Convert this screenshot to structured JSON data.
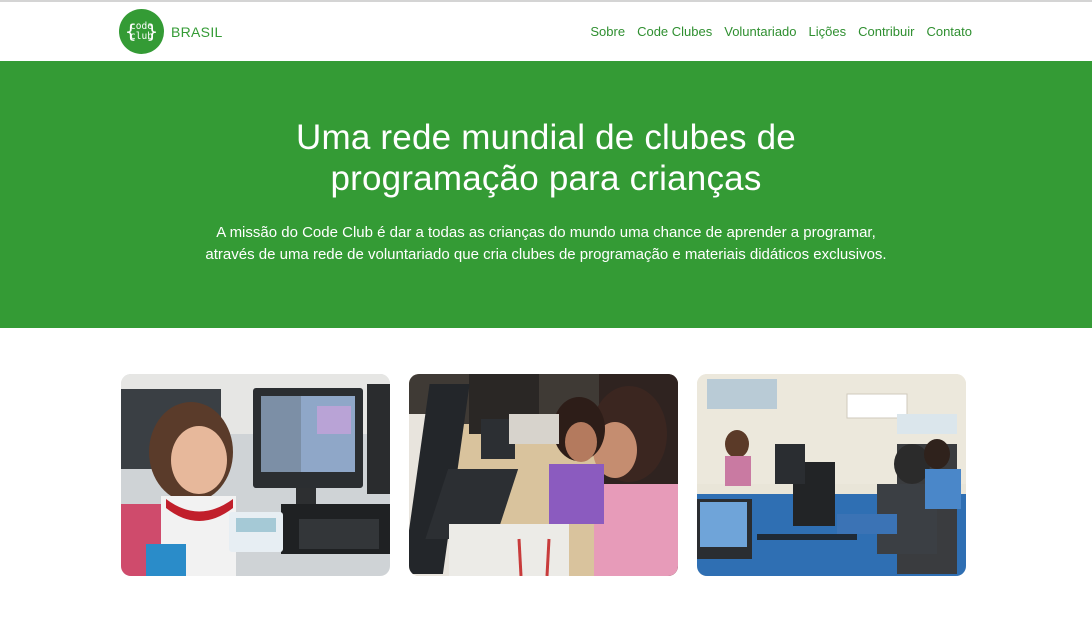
{
  "header": {
    "logo_line1": "code",
    "logo_line2": "club",
    "brand": "BRASIL",
    "nav": [
      "Sobre",
      "Code Clubes",
      "Voluntariado",
      "Lições",
      "Contribuir",
      "Contato"
    ]
  },
  "hero": {
    "title_line1": "Uma rede mundial de clubes de",
    "title_line2": "programação para crianças",
    "desc_line1": "A missão do Code Club é dar a todas as crianças do mundo uma chance de aprender a programar,",
    "desc_line2": "através de uma rede de voluntariado que cria clubes de programação e materiais didáticos exclusivos."
  },
  "colors": {
    "brand_green": "#349b35",
    "nav_green": "#2f8f30"
  },
  "gallery": {
    "photos": [
      "girl-with-badge-photo",
      "girls-at-computers-photo",
      "computer-lab-photo"
    ]
  }
}
